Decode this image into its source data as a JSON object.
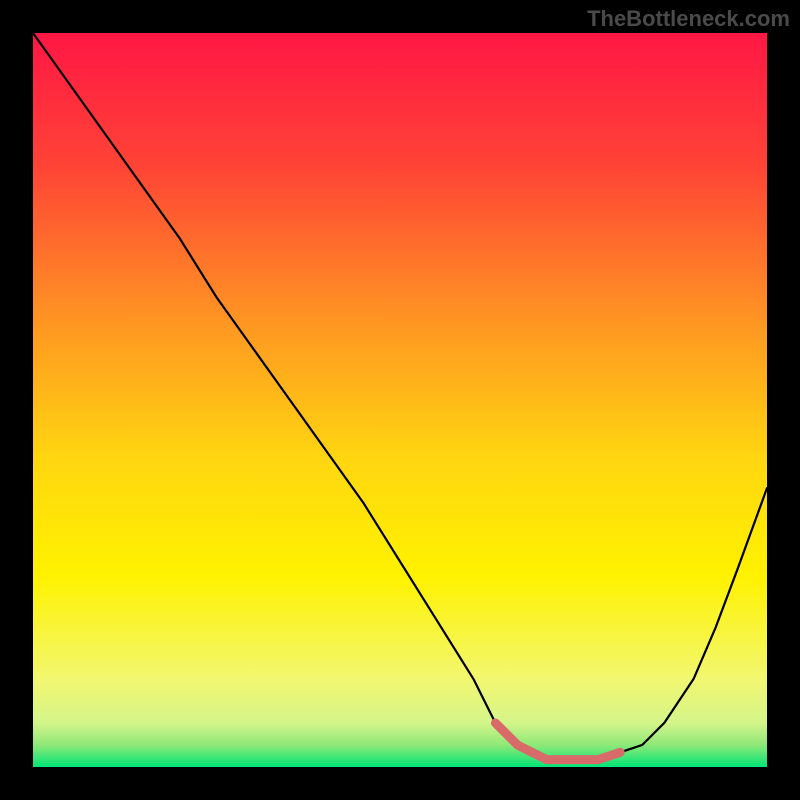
{
  "watermark": "TheBottleneck.com",
  "chart_data": {
    "type": "line",
    "title": "",
    "xlabel": "",
    "ylabel": "",
    "xlim": [
      0,
      100
    ],
    "ylim": [
      0,
      100
    ],
    "gradient_stops": [
      {
        "offset": 0,
        "color": "#ff1744"
      },
      {
        "offset": 18,
        "color": "#ff4336"
      },
      {
        "offset": 40,
        "color": "#ff9822"
      },
      {
        "offset": 58,
        "color": "#ffd610"
      },
      {
        "offset": 74,
        "color": "#fff200"
      },
      {
        "offset": 88,
        "color": "#f2f770"
      },
      {
        "offset": 94,
        "color": "#d4f58a"
      },
      {
        "offset": 97,
        "color": "#8ee878"
      },
      {
        "offset": 100,
        "color": "#00e676"
      }
    ],
    "curve": {
      "x": [
        0,
        5,
        10,
        15,
        20,
        25,
        30,
        35,
        40,
        45,
        50,
        55,
        60,
        63,
        66,
        70,
        74,
        77,
        80,
        83,
        86,
        90,
        93,
        96,
        100
      ],
      "y": [
        100,
        93,
        86,
        79,
        72,
        64,
        57,
        50,
        43,
        36,
        28,
        20,
        12,
        6,
        3,
        1,
        1,
        1,
        2,
        3,
        6,
        12,
        19,
        27,
        38
      ]
    },
    "highlight": {
      "color": "#d96a6a",
      "x": [
        63,
        66,
        70,
        74,
        77,
        80
      ],
      "y": [
        6,
        3,
        1,
        1,
        1,
        2
      ]
    }
  }
}
